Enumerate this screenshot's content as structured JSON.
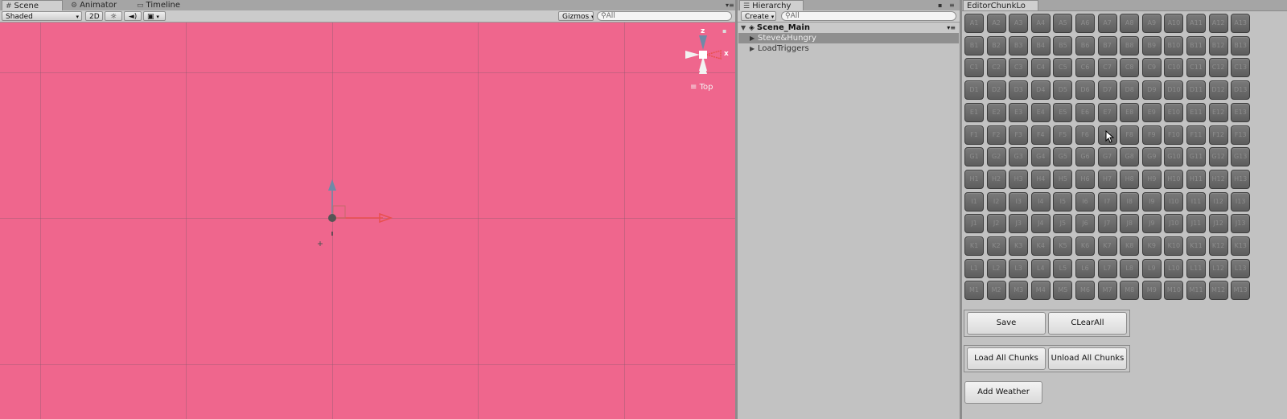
{
  "scene_panel": {
    "tabs": [
      {
        "label": "Scene",
        "icon": "grid-icon",
        "active": true
      },
      {
        "label": "Animator",
        "icon": "animator-icon",
        "active": false
      },
      {
        "label": "Timeline",
        "icon": "timeline-icon",
        "active": false
      }
    ],
    "toolbar": {
      "shading_mode": "Shaded",
      "mode_2d": "2D",
      "gizmos_label": "Gizmos",
      "search_placeholder": "All"
    },
    "view_label": "Top",
    "axis_labels": {
      "z": "z",
      "x": "x"
    }
  },
  "hierarchy_panel": {
    "tab_label": "Hierarchy",
    "create_label": "Create",
    "search_placeholder": "All",
    "scene_name": "Scene_Main",
    "items": [
      {
        "label": "Steve&Hungry",
        "selected": true
      },
      {
        "label": "LoadTriggers",
        "selected": false
      }
    ]
  },
  "chunk_panel": {
    "tab_label": "EditorChunkLo",
    "grid": {
      "rows": [
        "A",
        "B",
        "C",
        "D",
        "E",
        "F",
        "G",
        "H",
        "I",
        "J",
        "K",
        "L",
        "M"
      ],
      "columns": [
        "1",
        "2",
        "3",
        "4",
        "5",
        "6",
        "7",
        "8",
        "9",
        "10",
        "11",
        "12",
        "13"
      ]
    },
    "buttons": {
      "save": "Save",
      "clear_all": "CLearAll",
      "load_all": "Load All Chunks",
      "unload_all": "Unload All Chunks",
      "add_weather": "Add Weather"
    }
  },
  "colors": {
    "scene_background": "#ef668d",
    "panel_background": "#c2c2c2",
    "chunk_cell": "#6b6b6b",
    "axis_x": "#e8504f",
    "axis_y": "#6f8aa8"
  }
}
